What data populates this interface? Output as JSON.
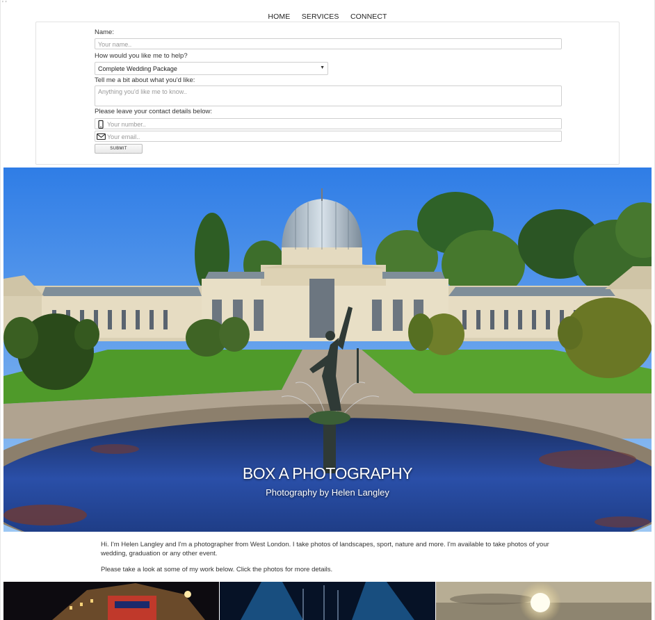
{
  "corner_mark": "' '",
  "nav": {
    "items": [
      {
        "label": "HOME"
      },
      {
        "label": "SERVICES"
      },
      {
        "label": "CONNECT"
      }
    ]
  },
  "form": {
    "name_label": "Name:",
    "name_placeholder": "Your name..",
    "help_label": "How would you like me to help?",
    "help_selected": "Complete Wedding Package",
    "about_label": "Tell me a bit about what you'd like:",
    "about_placeholder": "Anything you'd like me to know..",
    "contact_label": "Please leave your contact details below:",
    "number_placeholder": "Your number..",
    "email_placeholder": "Your email..",
    "submit_label": "SUBMIT"
  },
  "hero": {
    "title": "BOX A PHOTOGRAPHY",
    "subtitle": "Photography by Helen Langley"
  },
  "intro": {
    "paragraph1": "Hi. I'm Helen Langley and I'm a photographer from West London. I take photos of landscapes, sport, nature and more. I'm available to take photos of your wedding, graduation or any other event.",
    "paragraph2": "Please take a look at some of my work below. Click the photos for more details."
  },
  "icons": {
    "phone": "phone-icon",
    "email": "envelope-icon",
    "dropdown": "chevron-down-icon"
  },
  "colors": {
    "sky": "#3b86e8",
    "grass": "#4e9a2a",
    "water": "#1f3f8a",
    "text": "#333333"
  }
}
